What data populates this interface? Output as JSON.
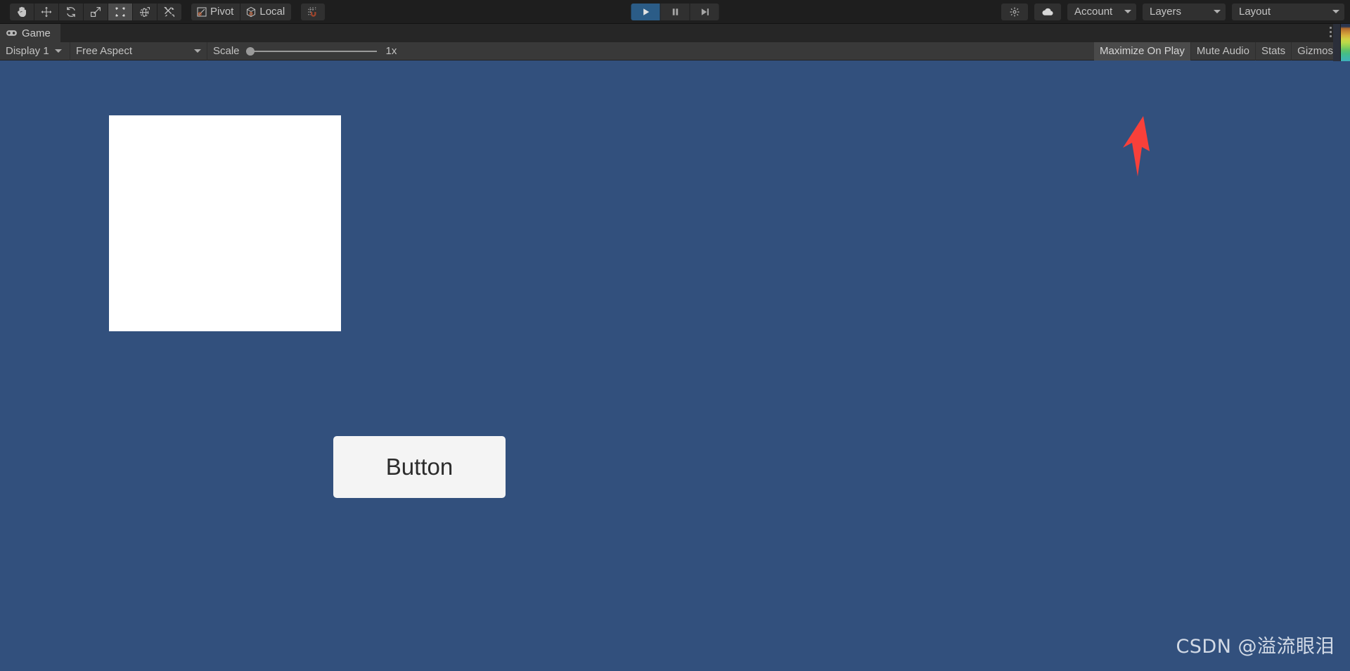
{
  "toolbar": {
    "transform_tools": [
      {
        "name": "hand-tool",
        "icon": "hand-icon",
        "active": false,
        "tooltip": "Hand Tool"
      },
      {
        "name": "move-tool",
        "icon": "move-icon",
        "active": false,
        "tooltip": "Move Tool"
      },
      {
        "name": "rotate-tool",
        "icon": "rotate-icon",
        "active": false,
        "tooltip": "Rotate Tool"
      },
      {
        "name": "scale-tool",
        "icon": "scale-icon",
        "active": false,
        "tooltip": "Scale Tool"
      },
      {
        "name": "rect-tool",
        "icon": "rect-transform-icon",
        "active": true,
        "tooltip": "Rect Transform Tool"
      },
      {
        "name": "transform-tool",
        "icon": "transform-icon",
        "active": false,
        "tooltip": "Transform Tool"
      },
      {
        "name": "custom-tool",
        "icon": "wrench-icon",
        "active": false,
        "tooltip": "Custom Editor Tool"
      }
    ],
    "pivot_label": "Pivot",
    "pivot_icon": "pivot-icon",
    "handle_label": "Local",
    "handle_icon": "local-handle-icon",
    "snap_icon": "grid-snap-magnet-icon",
    "play_controls": [
      {
        "name": "play-button",
        "icon": "play-icon",
        "active": true
      },
      {
        "name": "pause-button",
        "icon": "pause-icon",
        "active": false
      },
      {
        "name": "step-button",
        "icon": "step-icon",
        "active": false
      }
    ],
    "search_icon": "collab-search-icon",
    "cloud_icon": "cloud-icon",
    "account_label": "Account",
    "layers_label": "Layers",
    "layout_label": "Layout"
  },
  "tabs": [
    {
      "label": "Game",
      "icon": "gamepad-icon",
      "active": true
    }
  ],
  "game_toolbar": {
    "display_label": "Display 1",
    "aspect_label": "Free Aspect",
    "scale_label": "Scale",
    "scale_value": "1x",
    "scale_position_pct": 0,
    "maximize_on_play_label": "Maximize On Play",
    "mute_audio_label": "Mute Audio",
    "stats_label": "Stats",
    "gizmos_label": "Gizmos"
  },
  "game_view": {
    "background_color": "#32507d",
    "white_panel_color": "#ffffff",
    "ui_button_label": "Button",
    "ui_button_color": "#f4f4f4",
    "annotation": {
      "type": "arrow",
      "color": "#f8403a",
      "points_to": "Maximize On Play"
    }
  },
  "watermark": "CSDN @溢流眼泪"
}
